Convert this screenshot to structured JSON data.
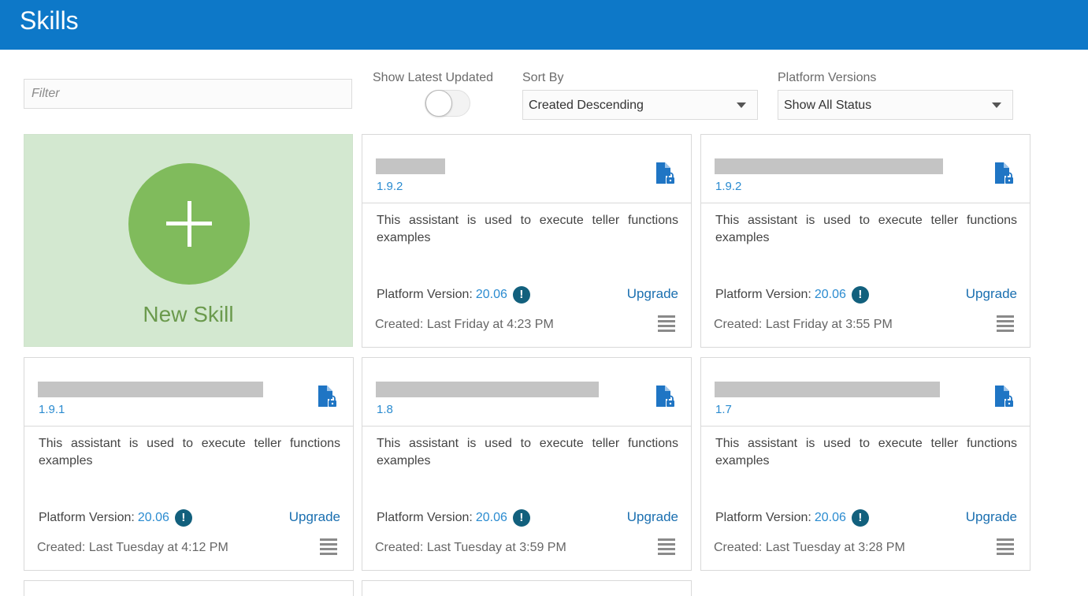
{
  "header": {
    "title": "Skills"
  },
  "toolbar": {
    "filter_placeholder": "Filter",
    "show_latest_label": "Show Latest Updated",
    "show_latest_on": false,
    "sort_label": "Sort By",
    "sort_value": "Created Descending",
    "platform_label": "Platform Versions",
    "platform_value": "Show All Status"
  },
  "new_skill": {
    "label": "New Skill"
  },
  "skills": [
    {
      "version": "1.9.2",
      "description": "This assistant is used to execute teller functions examples",
      "platform_label": "Platform Version:",
      "platform_version": "20.06",
      "upgrade_label": "Upgrade",
      "created": "Created: Last Friday at 4:23 PM"
    },
    {
      "version": "1.9.2",
      "description": "This assistant is used to execute teller functions examples",
      "platform_label": "Platform Version:",
      "platform_version": "20.06",
      "upgrade_label": "Upgrade",
      "created": "Created: Last Friday at 3:55 PM"
    },
    {
      "version": "1.9.1",
      "description": "This assistant is used to execute teller functions examples",
      "platform_label": "Platform Version:",
      "platform_version": "20.06",
      "upgrade_label": "Upgrade",
      "created": "Created: Last Tuesday at 4:12 PM"
    },
    {
      "version": "1.8",
      "description": "This assistant is used to execute teller functions examples",
      "platform_label": "Platform Version:",
      "platform_version": "20.06",
      "upgrade_label": "Upgrade",
      "created": "Created: Last Tuesday at 3:59 PM"
    },
    {
      "version": "1.7",
      "description": "This assistant is used to execute teller functions examples",
      "platform_label": "Platform Version:",
      "platform_version": "20.06",
      "upgrade_label": "Upgrade",
      "created": "Created: Last Tuesday at 3:28 PM"
    }
  ],
  "colors": {
    "header": "#0d78c8",
    "new_skill_bg": "#d3e8d0",
    "new_skill_circle": "#80bb5c",
    "link": "#2a8bd0",
    "warning": "#12607d"
  },
  "icons": {
    "card_icon": "document-lock-icon",
    "warning": "exclamation-icon",
    "menu": "hamburger-menu-icon",
    "add": "plus-icon"
  }
}
